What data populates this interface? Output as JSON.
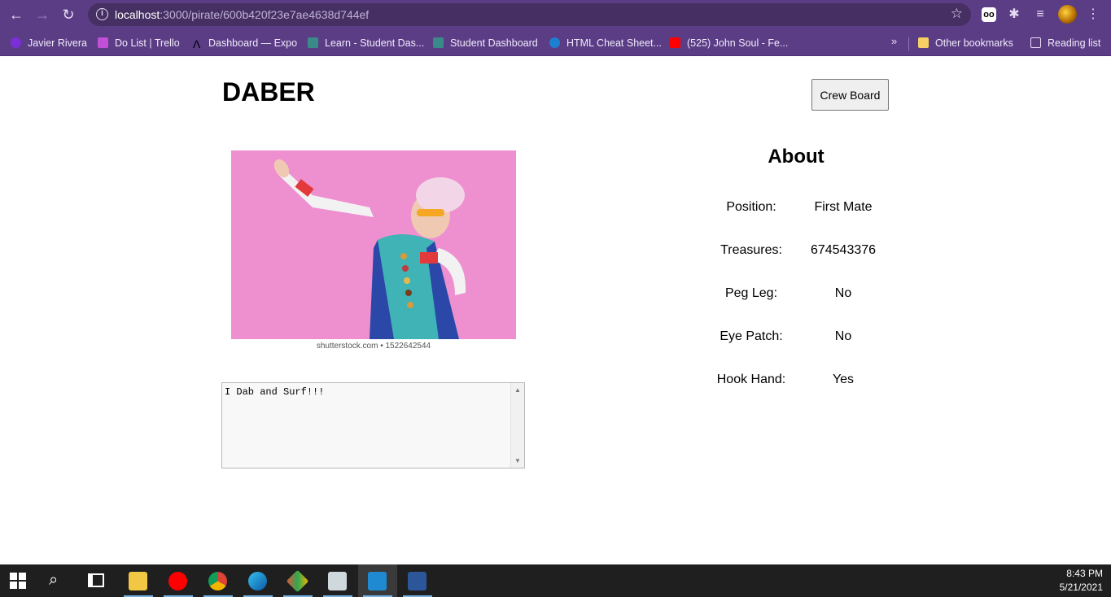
{
  "browser": {
    "url_host": "localhost",
    "url_path": ":3000/pirate/600b420f23e7ae4638d744ef",
    "bookmarks": [
      {
        "label": "Javier Rivera",
        "icon": "twitch-icon"
      },
      {
        "label": "Do List | Trello",
        "icon": "trello-icon"
      },
      {
        "label": "Dashboard — Expo",
        "icon": "expo-icon"
      },
      {
        "label": "Learn - Student Das...",
        "icon": "learn-icon"
      },
      {
        "label": "Student Dashboard",
        "icon": "learn-icon"
      },
      {
        "label": "HTML Cheat Sheet...",
        "icon": "html-icon"
      },
      {
        "label": "(525) John Soul - Fe...",
        "icon": "youtube-icon"
      }
    ],
    "more_label": "»",
    "other_bookmarks": "Other bookmarks",
    "reading_list": "Reading list"
  },
  "page": {
    "title": "DABER",
    "crew_button": "Crew Board",
    "image_caption": "shutterstock.com • 1522642544",
    "bio": "I Dab and Surf!!!",
    "about_title": "About",
    "about": [
      {
        "label": "Position:",
        "value": "First Mate"
      },
      {
        "label": "Treasures:",
        "value": "674543376"
      },
      {
        "label": "Peg Leg:",
        "value": "No"
      },
      {
        "label": "Eye Patch:",
        "value": "No"
      },
      {
        "label": "Hook Hand:",
        "value": "Yes"
      }
    ]
  },
  "taskbar": {
    "time": "8:43 PM",
    "date": "5/21/2021",
    "apps": [
      "file-explorer-icon",
      "youtube-music-icon",
      "chrome-icon",
      "edge-icon",
      "git-icon",
      "drive-icon",
      "vscode-icon",
      "word-icon"
    ]
  },
  "colors": {
    "chrome_bg": "#5b3d86",
    "omnibox_bg": "#463063",
    "photo_pink": "#ee8fd0"
  }
}
